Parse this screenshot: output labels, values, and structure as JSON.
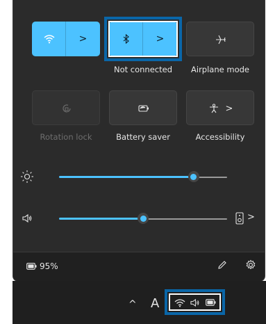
{
  "quick_settings": {
    "tiles": [
      {
        "id": "wifi",
        "label": "",
        "active": true,
        "icon": "wifi-icon"
      },
      {
        "id": "bluetooth",
        "label": "Not connected",
        "active": true,
        "icon": "bluetooth-icon"
      },
      {
        "id": "airplane",
        "label": "Airplane mode",
        "active": false,
        "icon": "airplane-icon"
      },
      {
        "id": "rotation",
        "label": "Rotation lock",
        "active": false,
        "disabled": true,
        "icon": "rotation-lock-icon"
      },
      {
        "id": "battery_saver",
        "label": "Battery saver",
        "active": false,
        "icon": "battery-saver-icon"
      },
      {
        "id": "accessibility",
        "label": "Accessibility",
        "active": false,
        "icon": "accessibility-icon"
      }
    ],
    "brightness": {
      "value_fraction": 0.8,
      "icon": "brightness-icon"
    },
    "volume": {
      "value_fraction": 0.5,
      "icon": "speaker-icon"
    },
    "chevron": ">",
    "battery_percent": "95%",
    "accent_color": "#4cc2ff"
  },
  "taskbar": {
    "overflow_chevron": "^",
    "partial_letter": "A",
    "tray_icons": [
      "wifi-icon",
      "speaker-icon",
      "battery-icon"
    ]
  }
}
